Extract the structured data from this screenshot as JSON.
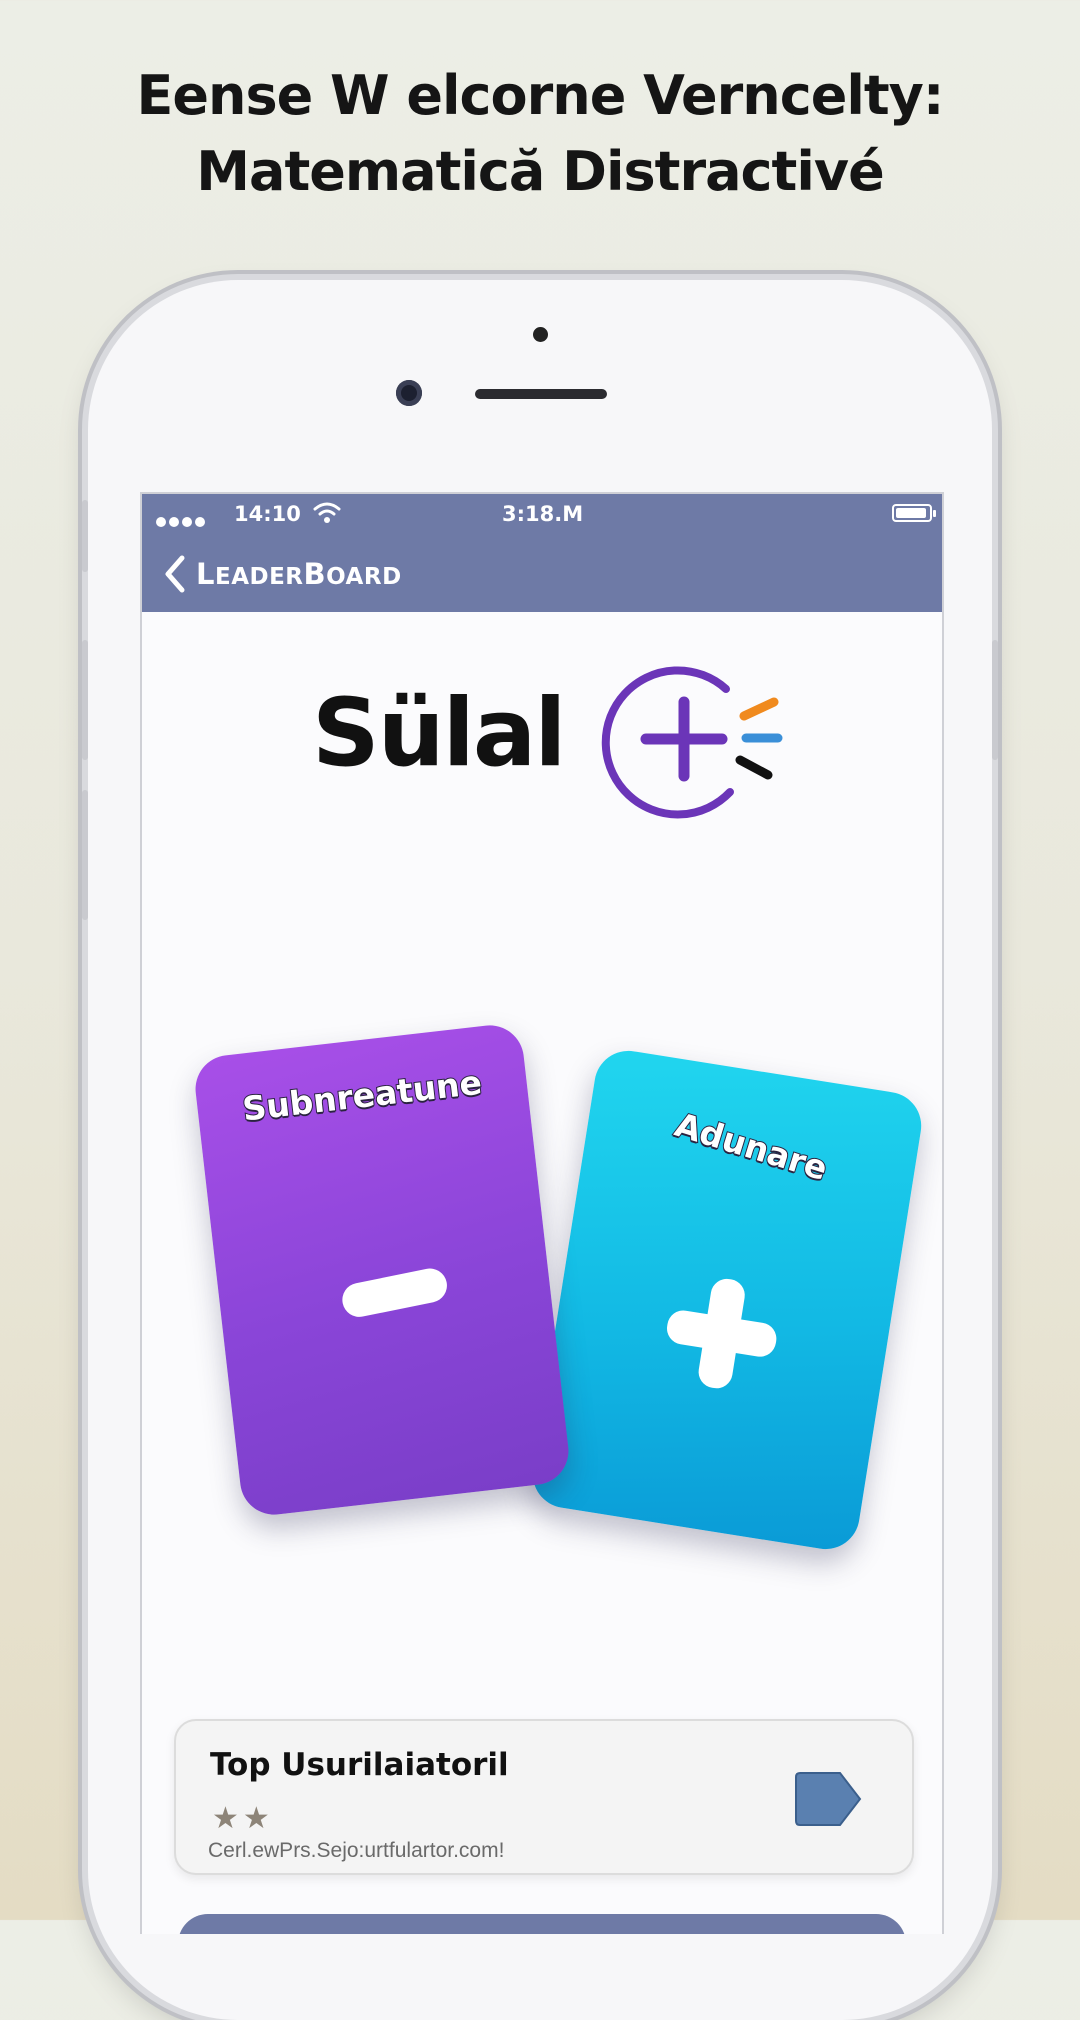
{
  "headline": {
    "line1": "Eense W elcorne Verncelty:",
    "line2": "Matematică Distractivé"
  },
  "status_bar": {
    "time_left": "14:10",
    "time_center": "3:18.M"
  },
  "nav": {
    "back_label_first": "L",
    "back_label_rest": "EADER",
    "back_label_b": "B",
    "back_label_end": "OARD"
  },
  "logo": {
    "text": "Sülal"
  },
  "cards": [
    {
      "label": "Subnreatune",
      "icon": "minus-icon",
      "color": "#9a4ae0"
    },
    {
      "label": "Adunare",
      "icon": "plus-icon",
      "color": "#14bde6"
    }
  ],
  "leaderboard_card": {
    "title": "Top Usurilaiatoril",
    "stars": "★★",
    "url": "Cerl.ewPrs.Sejo:urtfulartor.com!",
    "icon": "tag-arrow-icon"
  },
  "colors": {
    "nav_bar": "#6e7aa6",
    "logo_purple": "#6b35b8",
    "logo_orange": "#f08a1e",
    "logo_blue": "#3a8fd8"
  }
}
